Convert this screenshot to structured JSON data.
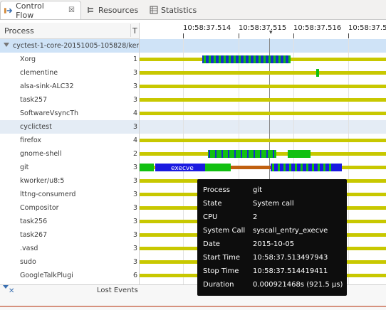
{
  "tabs": [
    {
      "label": "Control Flow",
      "icon": "control-flow-icon",
      "active": true
    },
    {
      "label": "Resources",
      "icon": "resources-icon",
      "active": false
    },
    {
      "label": "Statistics",
      "icon": "statistics-icon",
      "active": false
    }
  ],
  "tree": {
    "header_process": "Process",
    "header_tid": "T",
    "parent": {
      "name": "cyctest-1-core-20151005-105828/kernel",
      "cpu": ""
    },
    "rows": [
      {
        "name": "Xorg",
        "cpu": "1"
      },
      {
        "name": "clementine",
        "cpu": "3"
      },
      {
        "name": "alsa-sink-ALC32",
        "cpu": "3"
      },
      {
        "name": "task257",
        "cpu": "3"
      },
      {
        "name": "SoftwareVsyncTh",
        "cpu": "4"
      },
      {
        "name": "cyclictest",
        "cpu": "3"
      },
      {
        "name": "firefox",
        "cpu": "4"
      },
      {
        "name": "gnome-shell",
        "cpu": "2"
      },
      {
        "name": "git",
        "cpu": "3"
      },
      {
        "name": "kworker/u8:5",
        "cpu": "3"
      },
      {
        "name": "lttng-consumerd",
        "cpu": "3"
      },
      {
        "name": "Compositor",
        "cpu": "3"
      },
      {
        "name": "task256",
        "cpu": "3"
      },
      {
        "name": "task267",
        "cpu": "3"
      },
      {
        "name": ".vasd",
        "cpu": "3"
      },
      {
        "name": "sudo",
        "cpu": "3"
      },
      {
        "name": "GoogleTalkPlugi",
        "cpu": "6"
      }
    ]
  },
  "timeaxis": [
    "10:58:37.514",
    "10:58:37.515",
    "10:58:37.516",
    "10:58:37.51"
  ],
  "git_state_label": "execve",
  "bottom": {
    "lost_events": "Lost Events"
  },
  "tooltip": [
    {
      "key": "Process",
      "value": "git"
    },
    {
      "key": "State",
      "value": "System call"
    },
    {
      "key": "CPU",
      "value": "2"
    },
    {
      "key": "System Call",
      "value": "syscall_entry_execve"
    },
    {
      "key": "Date",
      "value": "2015-10-05"
    },
    {
      "key": "Start Time",
      "value": "10:58:37.513497943"
    },
    {
      "key": "Stop Time",
      "value": "10:58:37.514419411"
    },
    {
      "key": "Duration",
      "value": "0.000921468s (921.5 µs)"
    }
  ],
  "colors": {
    "waiting": "#c8c800",
    "running": "#11c011",
    "usermode": "#1430c8",
    "syscall": "#1a1ae0",
    "interrupted": "#c06010",
    "accent": "#3a6fb0"
  }
}
